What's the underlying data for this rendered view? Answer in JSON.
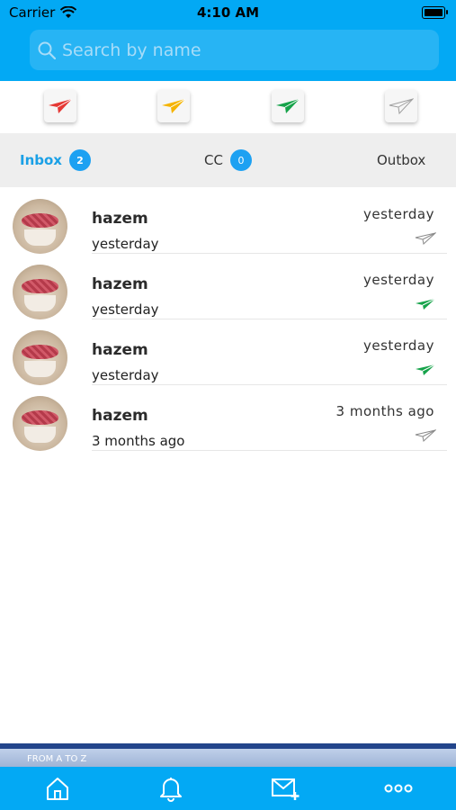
{
  "status_bar": {
    "carrier": "Carrier",
    "time": "4:10 AM"
  },
  "search": {
    "placeholder": "Search by name"
  },
  "filters": [
    {
      "name": "red-plane-filter",
      "color": "#e53935"
    },
    {
      "name": "yellow-plane-filter",
      "color": "#f5b400"
    },
    {
      "name": "green-plane-filter",
      "color": "#16a34a"
    },
    {
      "name": "outline-plane-filter",
      "color": "#9e9e9e"
    }
  ],
  "tabs": {
    "inbox_label": "Inbox",
    "inbox_count": "2",
    "cc_label": "CC",
    "cc_count": "0",
    "outbox_label": "Outbox"
  },
  "messages": [
    {
      "name": "hazem",
      "subtitle": "yesterday",
      "time": "yesterday",
      "status_icon": "outline-plane-icon"
    },
    {
      "name": "hazem",
      "subtitle": "yesterday",
      "time": "yesterday",
      "status_icon": "green-plane-icon"
    },
    {
      "name": "hazem",
      "subtitle": "yesterday",
      "time": "yesterday",
      "status_icon": "green-plane-icon"
    },
    {
      "name": "hazem",
      "subtitle": "3 months ago",
      "time": "3 months ago",
      "status_icon": "outline-plane-icon"
    }
  ],
  "ad_banner": {
    "text": "FROM A TO Z"
  },
  "bottom_nav": [
    "home-icon",
    "bell-icon",
    "compose-mail-icon",
    "more-icon"
  ],
  "colors": {
    "primary": "#03a9f4",
    "badge": "#1da1f2",
    "active_tab": "#1aa0e6"
  }
}
